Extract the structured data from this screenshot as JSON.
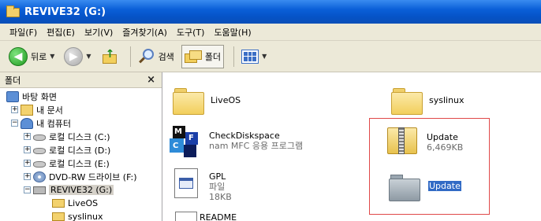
{
  "window": {
    "title": "REVIVE32 (G:)"
  },
  "menu": {
    "items": [
      "파일(F)",
      "편집(E)",
      "보기(V)",
      "즐겨찾기(A)",
      "도구(T)",
      "도움말(H)"
    ]
  },
  "toolbar": {
    "back_label": "뒤로",
    "search_label": "검색",
    "folders_label": "폴더"
  },
  "folder_pane": {
    "title": "폴더",
    "close_glyph": "×",
    "tree": [
      {
        "label": "바탕 화면",
        "icon": "desktop-icon",
        "expander": ""
      },
      {
        "label": "내 문서",
        "icon": "my-documents-icon",
        "expander": "+"
      },
      {
        "label": "내 컴퓨터",
        "icon": "my-computer-icon",
        "expander": "−"
      },
      {
        "label": "로컬 디스크 (C:)",
        "icon": "local-disk-icon",
        "expander": "+"
      },
      {
        "label": "로컬 디스크 (D:)",
        "icon": "local-disk-icon",
        "expander": "+"
      },
      {
        "label": "로컬 디스크 (E:)",
        "icon": "local-disk-icon",
        "expander": "+"
      },
      {
        "label": "DVD-RW 드라이브 (F:)",
        "icon": "dvd-drive-icon",
        "expander": "+"
      },
      {
        "label": "REVIVE32 (G:)",
        "icon": "removable-drive-icon",
        "expander": "−"
      },
      {
        "label": "LiveOS",
        "icon": "folder-icon",
        "expander": ""
      },
      {
        "label": "syslinux",
        "icon": "folder-icon",
        "expander": ""
      }
    ]
  },
  "contents": {
    "items": [
      {
        "name": "LiveOS",
        "sub": "",
        "icon": "folder-icon"
      },
      {
        "name": "syslinux",
        "sub": "",
        "icon": "folder-icon"
      },
      {
        "name": "CheckDiskspace",
        "sub": "nam MFC 응용 프로그램",
        "icon": "mfc-application-icon"
      },
      {
        "name": "Update",
        "sub": "6,469KB",
        "icon": "zip-folder-icon"
      },
      {
        "name": "GPL",
        "sub": "파일",
        "sub2": "18KB",
        "icon": "file-icon"
      },
      {
        "name": "Update",
        "sub": "",
        "icon": "folder-icon-gray"
      },
      {
        "name": "README",
        "sub": "",
        "icon": "file-icon"
      }
    ]
  },
  "colors": {
    "titlebar": "#0a5fd8",
    "selection": "#316ac5",
    "highlight_box": "#e04848"
  }
}
